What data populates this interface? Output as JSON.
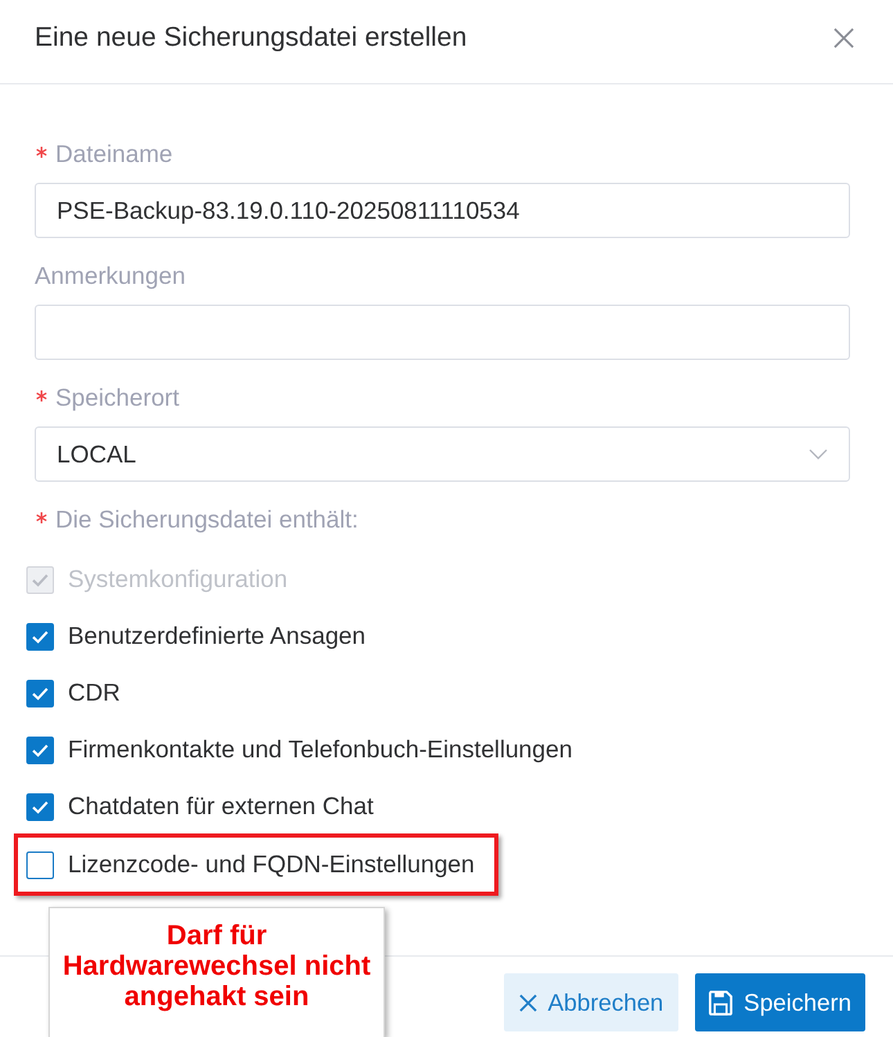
{
  "dialog": {
    "title": "Eine neue Sicherungsdatei erstellen"
  },
  "fields": [
    {
      "kind": "text",
      "label": "Dateiname",
      "required": true,
      "value": "PSE-Backup-83.19.0.110-20250811110534"
    },
    {
      "kind": "text",
      "label": "Anmerkungen",
      "required": false
    },
    {
      "kind": "select",
      "label": "Speicherort",
      "required": true,
      "value": "LOCAL"
    }
  ],
  "contents": {
    "label": "Die Sicherungsdatei enthält:",
    "required": true,
    "options": [
      {
        "label": "Systemkonfiguration",
        "checked": true,
        "disabled": true,
        "highlighted": false
      },
      {
        "label": "Benutzerdefinierte Ansagen",
        "checked": true,
        "disabled": false,
        "highlighted": false
      },
      {
        "label": "CDR",
        "checked": true,
        "disabled": false,
        "highlighted": false
      },
      {
        "label": "Firmenkontakte und Telefonbuch-Einstellungen",
        "checked": true,
        "disabled": false,
        "highlighted": false
      },
      {
        "label": "Chatdaten für externen Chat",
        "checked": true,
        "disabled": false,
        "highlighted": false
      },
      {
        "label": "Lizenzcode- und FQDN-Einstellungen",
        "checked": false,
        "disabled": false,
        "highlighted": true
      }
    ]
  },
  "buttons": [
    {
      "kind": "cancel",
      "label": "Abbrechen"
    },
    {
      "kind": "save",
      "label": "Speichern"
    }
  ],
  "callout": {
    "text": "Darf für Hardwarewechsel nicht angehakt sein"
  }
}
